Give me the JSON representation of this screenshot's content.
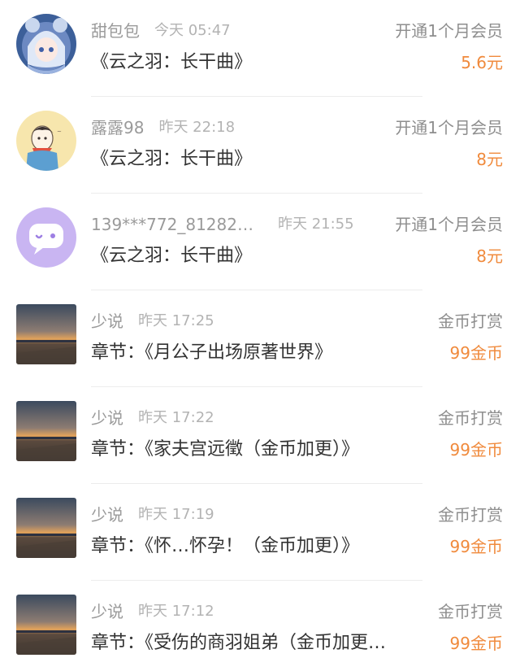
{
  "records": [
    {
      "avatar_icon": "anime-girl-avatar",
      "name": "甜包包",
      "time": "今天 05:47",
      "title": "《云之羽：长干曲》",
      "type": "开通1个月会员",
      "amount": "5.6元"
    },
    {
      "avatar_icon": "cartoon-boy-avatar",
      "name": "露露98",
      "time": "昨天 22:18",
      "title": "《云之羽：长干曲》",
      "type": "开通1个月会员",
      "amount": "8元"
    },
    {
      "avatar_icon": "chat-bubble-avatar",
      "name": "139***772_81282…",
      "time": "昨天 21:55",
      "title": "《云之羽：长干曲》",
      "type": "开通1个月会员",
      "amount": "8元"
    },
    {
      "avatar_icon": "sunset-photo-avatar",
      "name": "少说",
      "time": "昨天 17:25",
      "title": "章节：《月公子出场原著世界》",
      "type": "金币打赏",
      "amount": "99金币"
    },
    {
      "avatar_icon": "sunset-photo-avatar",
      "name": "少说",
      "time": "昨天 17:22",
      "title": "章节：《家夫宫远徵（金币加更）》",
      "type": "金币打赏",
      "amount": "99金币"
    },
    {
      "avatar_icon": "sunset-photo-avatar",
      "name": "少说",
      "time": "昨天 17:19",
      "title": "章节：《怀…怀孕！（金币加更）》",
      "type": "金币打赏",
      "amount": "99金币"
    },
    {
      "avatar_icon": "sunset-photo-avatar",
      "name": "少说",
      "time": "昨天 17:12",
      "title": "章节：《受伤的商羽姐弟（金币加更…",
      "type": "金币打赏",
      "amount": "99金币"
    }
  ],
  "colors": {
    "amount": "#f08a3c",
    "name": "#9a9a9a",
    "time": "#b3b3b3",
    "title": "#333333",
    "type": "#8e8e8e"
  }
}
